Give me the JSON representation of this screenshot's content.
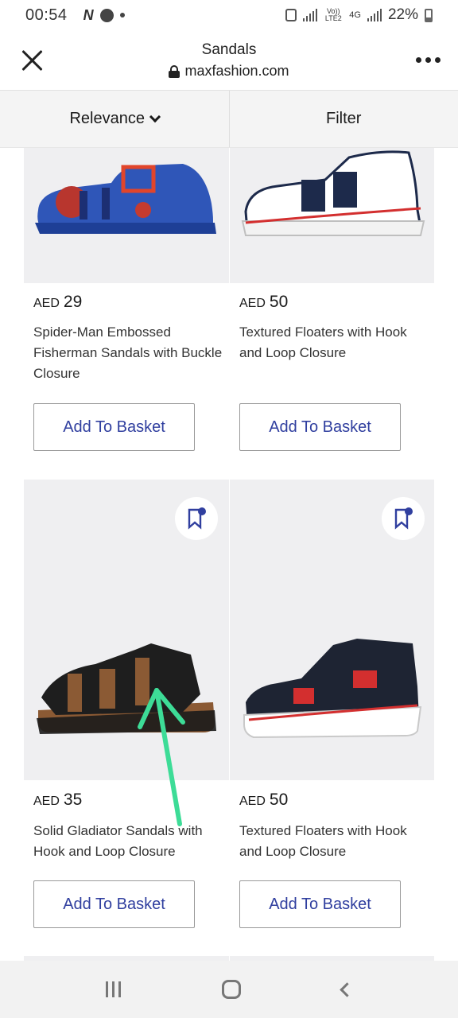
{
  "status_bar": {
    "time": "00:54",
    "left_icons": [
      "n-icon",
      "messenger-icon",
      "dot-icon"
    ],
    "battery": "22%",
    "network": "4G",
    "volte": "Vo)) LTE2"
  },
  "header": {
    "title": "Sandals",
    "url": "maxfashion.com"
  },
  "sort_bar": {
    "sort_label": "Relevance",
    "filter_label": "Filter"
  },
  "products": [
    {
      "currency": "AED",
      "price": "29",
      "title": "Spider-Man Embossed Fisherman Sandals with Buckle Closure",
      "button": "Add To Basket"
    },
    {
      "currency": "AED",
      "price": "50",
      "title": "Textured Floaters with Hook and Loop Closure",
      "button": "Add To Basket"
    },
    {
      "currency": "AED",
      "price": "35",
      "title": "Solid Gladiator Sandals with Hook and Loop Closure",
      "button": "Add To Basket"
    },
    {
      "currency": "AED",
      "price": "50",
      "title": "Textured Floaters with Hook and Loop Closure",
      "button": "Add To Basket"
    }
  ],
  "colors": {
    "accent": "#303f9f",
    "annotation_arrow": "#3ddc97"
  }
}
